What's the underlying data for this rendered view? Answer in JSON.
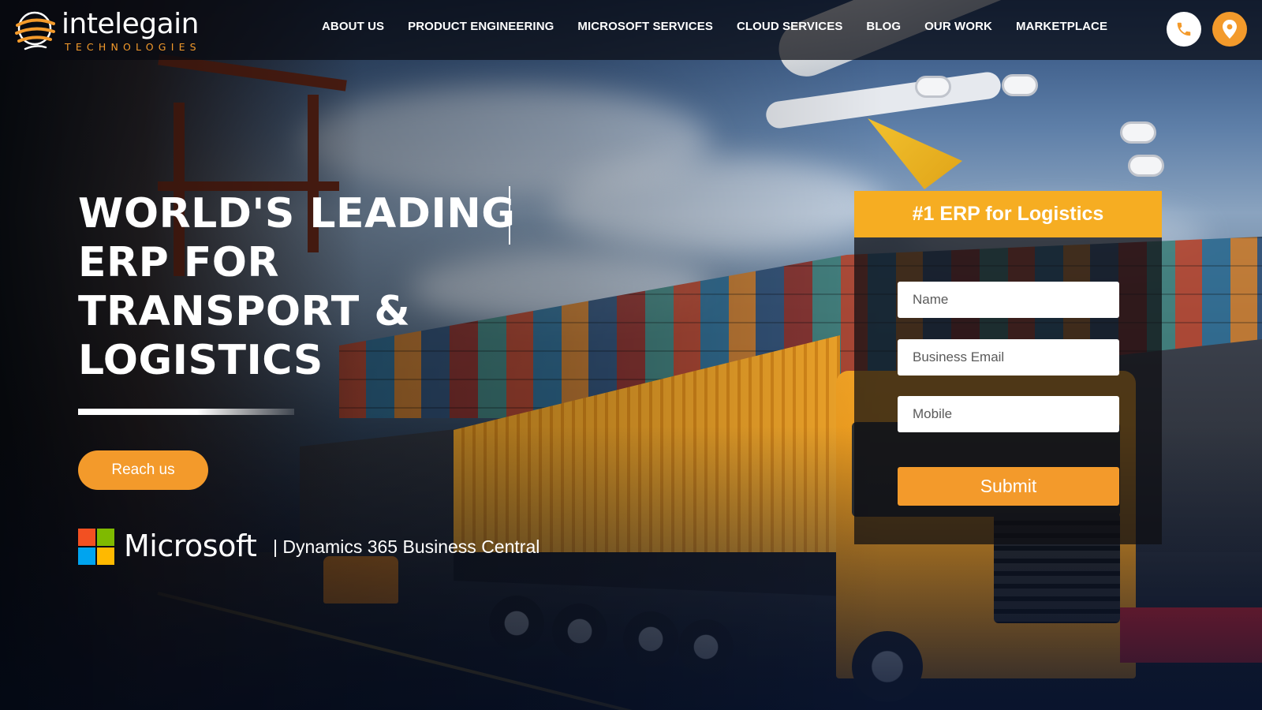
{
  "brand": {
    "name": "intelegain",
    "tagline": "TECHNOLOGIES",
    "accent_color": "#f39a2b"
  },
  "nav": {
    "items": [
      {
        "label": "ABOUT US"
      },
      {
        "label": "PRODUCT ENGINEERING"
      },
      {
        "label": "MICROSOFT SERVICES"
      },
      {
        "label": "CLOUD SERVICES"
      },
      {
        "label": "BLOG"
      },
      {
        "label": "OUR WORK"
      },
      {
        "label": "MARKETPLACE"
      }
    ],
    "icons": [
      "phone-icon",
      "location-pin-icon"
    ]
  },
  "hero": {
    "headline_lines": [
      "WORLD'S LEADING",
      "ERP FOR",
      "TRANSPORT &",
      "LOGISTICS"
    ],
    "cta_label": "Reach us",
    "partner_name": "Microsoft",
    "partner_product": "|  Dynamics 365 Business Central",
    "partner_logo_colors": [
      "#f25022",
      "#7fba00",
      "#00a4ef",
      "#ffb900"
    ]
  },
  "form": {
    "title": "#1 ERP for Logistics",
    "title_bg_color": "#f6ad22",
    "fields": {
      "name": {
        "placeholder": "Name",
        "value": ""
      },
      "email": {
        "placeholder": "Business Email",
        "value": ""
      },
      "mobile": {
        "placeholder": "Mobile",
        "value": ""
      }
    },
    "submit_label": "Submit"
  }
}
